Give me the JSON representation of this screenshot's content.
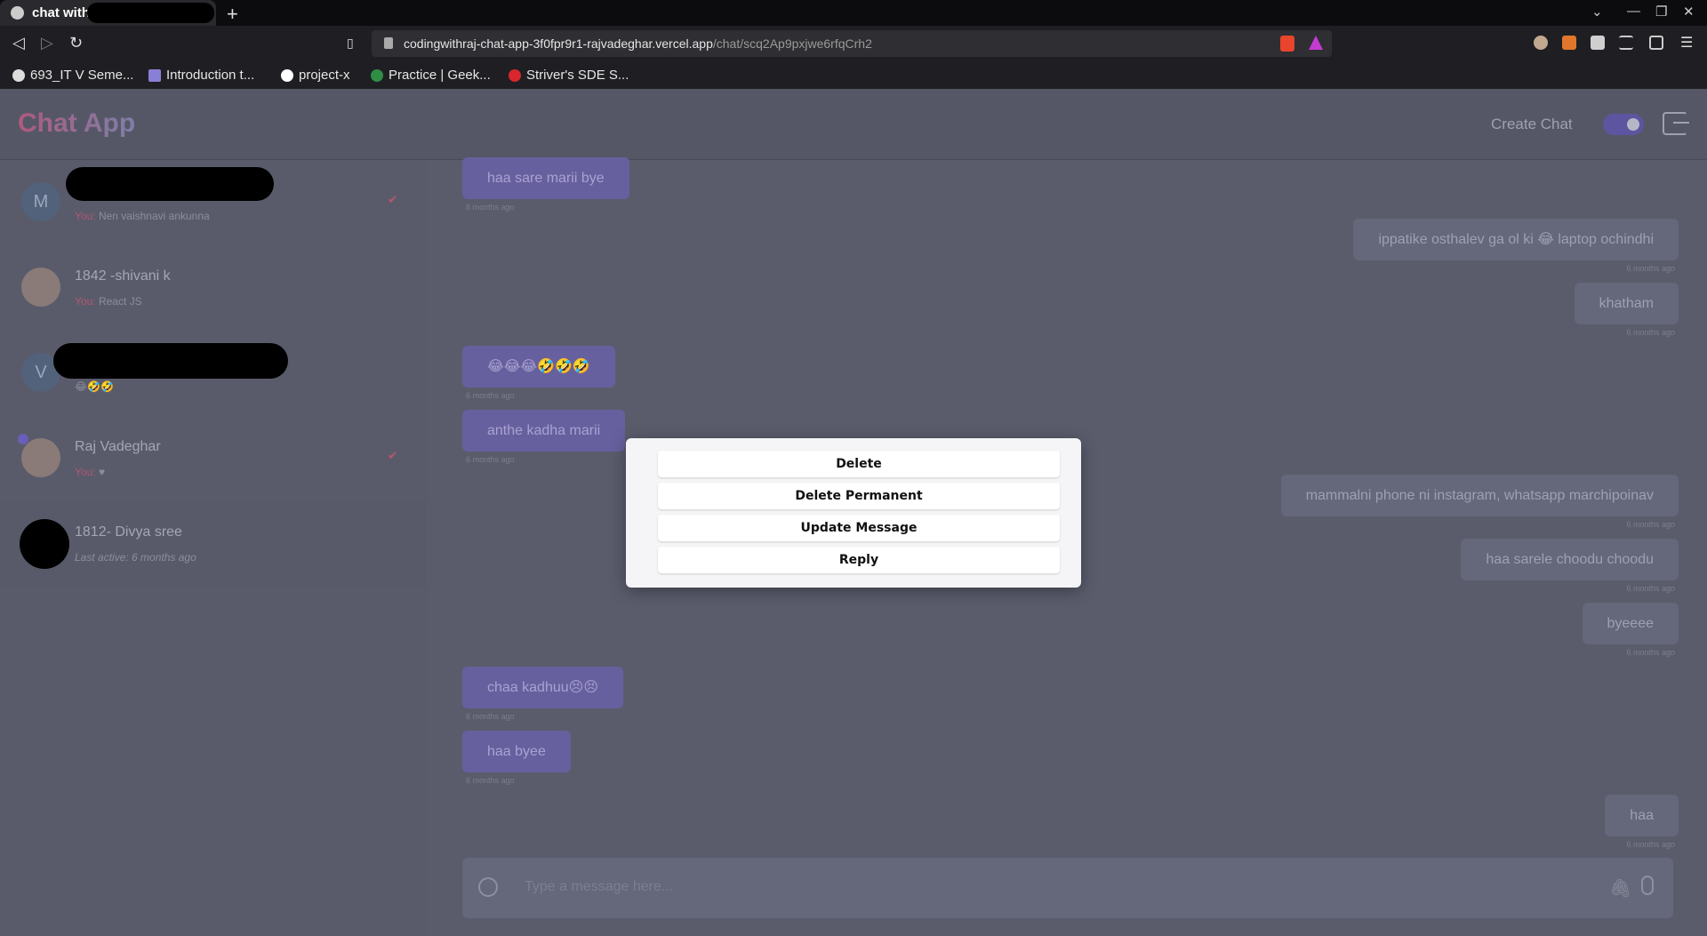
{
  "browser": {
    "tab_title": "chat with",
    "url_host": "codingwithraj-chat-app-3f0fpr9r1-rajvadeghar.vercel.app",
    "url_path": "/chat/scq2Ap9pxjwe6rfqCrh2",
    "bookmarks": [
      {
        "label": "693_IT V Seme...",
        "icon": "globe-icon",
        "color": "#dddddd"
      },
      {
        "label": "Introduction t...",
        "icon": "ethereum-icon",
        "color": "#8a7fd6"
      },
      {
        "label": "project-x",
        "icon": "github-icon",
        "color": "#ffffff"
      },
      {
        "label": "Practice | Geek...",
        "icon": "geeksforgeeks-icon",
        "color": "#2f8d46"
      },
      {
        "label": "Striver's SDE S...",
        "icon": "tuf-icon",
        "color": "#d8262c"
      }
    ]
  },
  "header": {
    "logo": "Chat App",
    "create_chat": "Create Chat"
  },
  "sidebar": {
    "contacts": [
      {
        "name": "",
        "avatar": "M",
        "you": "You:",
        "message": "Nen vaishnavi ankunna",
        "read_tick": true
      },
      {
        "name": "1842 -shivani k",
        "avatar": "",
        "you": "You:",
        "message": "React JS",
        "read_tick": false
      },
      {
        "name": "",
        "avatar": "V",
        "you": "",
        "message": "😂🤣🤣",
        "read_tick": false
      },
      {
        "name": "Raj Vadeghar",
        "avatar": "",
        "you": "You:",
        "message": "♥",
        "read_tick": true
      },
      {
        "name": "1812- Divya sree",
        "avatar": "",
        "you": "",
        "message": "Last active: 6 months ago",
        "read_tick": false
      }
    ]
  },
  "messages": [
    {
      "text": "haa sare marii bye",
      "dir": "in",
      "time": "6 months ago"
    },
    {
      "text": "ippatike osthalev ga ol ki 😂 laptop ochindhi",
      "dir": "out",
      "time": "6 months ago"
    },
    {
      "text": "khatham",
      "dir": "out",
      "time": "6 months ago"
    },
    {
      "text": "😂😂😂🤣🤣🤣",
      "dir": "in",
      "time": "6 months ago"
    },
    {
      "text": "anthe kadha marii",
      "dir": "in",
      "time": "6 months ago"
    },
    {
      "text": "mammalni phone ni instagram, whatsapp marchipoinav",
      "dir": "out",
      "time": "6 months ago"
    },
    {
      "text": "haa sarele choodu choodu",
      "dir": "out",
      "time": "6 months ago"
    },
    {
      "text": "byeeee",
      "dir": "out",
      "time": "6 months ago"
    },
    {
      "text": "chaa kadhuu😣😣",
      "dir": "in",
      "time": "6 months ago"
    },
    {
      "text": "haa byee",
      "dir": "in",
      "time": "6 months ago"
    },
    {
      "text": "haa",
      "dir": "out",
      "time": "6 months ago"
    }
  ],
  "composer": {
    "placeholder": "Type a message here..."
  },
  "context_menu": {
    "options": [
      "Delete",
      "Delete Permanent",
      "Update Message",
      "Reply"
    ]
  },
  "colors": {
    "accent": "#6a5fb8",
    "you_label": "#b3566f"
  }
}
